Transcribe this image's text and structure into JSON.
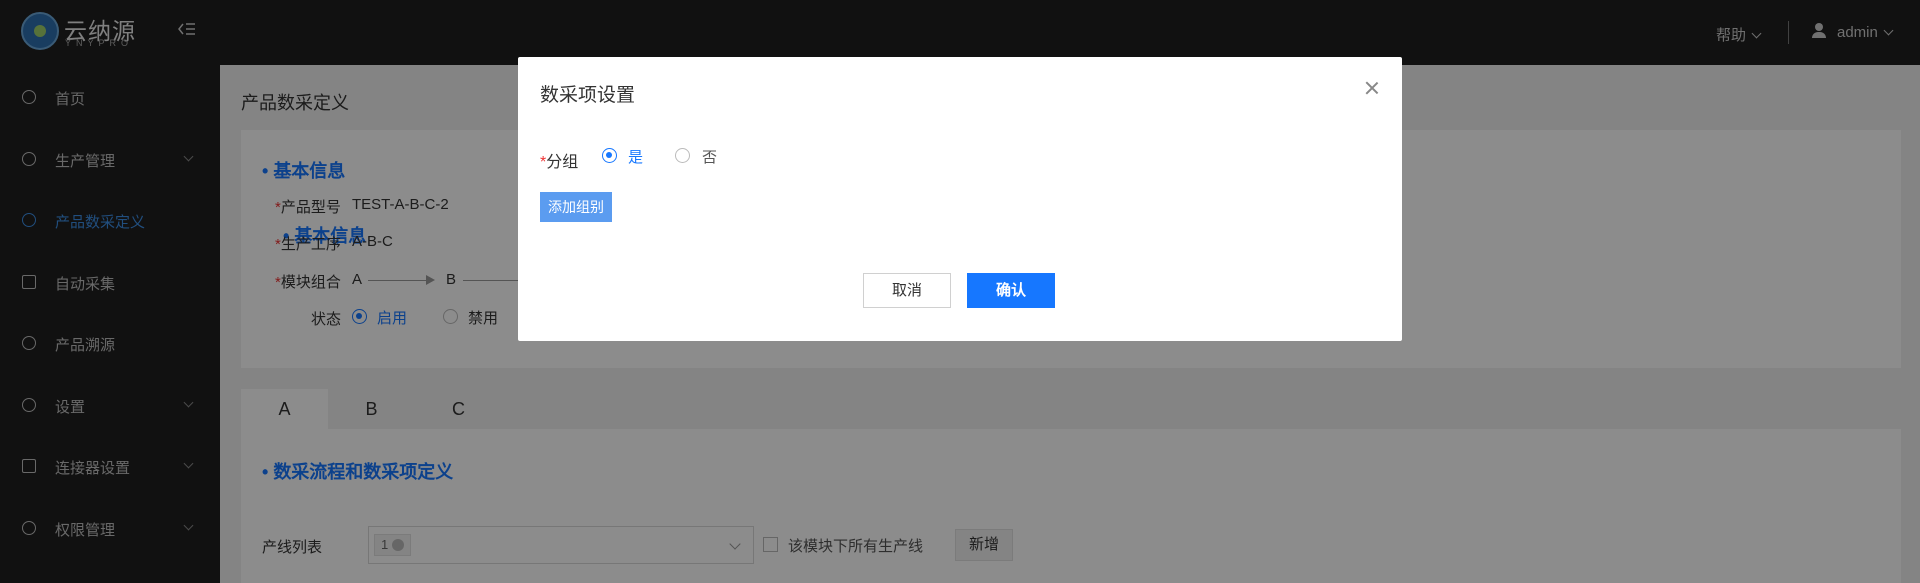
{
  "header": {
    "logo_text": "云纳源",
    "logo_sub": "YNYPRO",
    "help_label": "帮助",
    "user_name": "admin"
  },
  "sidebar": {
    "items": [
      {
        "label": "首页",
        "icon": "dashboard-icon"
      },
      {
        "label": "生产管理",
        "icon": "production-icon"
      },
      {
        "label": "产品数采定义",
        "icon": "product-def-icon",
        "active": true
      },
      {
        "label": "自动采集",
        "icon": "collect-icon"
      },
      {
        "label": "产品溯源",
        "icon": "trace-icon"
      },
      {
        "label": "设置",
        "icon": "settings-icon"
      },
      {
        "label": "连接器设置",
        "icon": "connector-icon"
      },
      {
        "label": "权限管理",
        "icon": "permission-icon"
      }
    ]
  },
  "page": {
    "title": "产品数采定义",
    "basic_info_title": "基本信息",
    "model_label": "产品型号",
    "model_value": "TEST-A-B-C-2",
    "process_label": "生产工序",
    "process_value": "A-B-C",
    "module_label": "模块组合",
    "module_nodes": [
      "A",
      "B"
    ],
    "status_label": "状态",
    "status_on": "启用",
    "status_off": "禁用",
    "tabs": [
      "A",
      "B",
      "C"
    ],
    "flow_title": "数采流程和数采项定义",
    "line_list_label": "产线列表",
    "line_tag": "1",
    "all_lines_label": "该模块下所有生产线",
    "add_label": "新增"
  },
  "modal": {
    "title": "数采项设置",
    "group_label": "分组",
    "yes_label": "是",
    "no_label": "否",
    "add_group_label": "添加组别",
    "cancel_label": "取消",
    "ok_label": "确认"
  },
  "colors": {
    "primary": "#1677ff",
    "sidebar_bg": "#1f1f1f",
    "active_nav": "#3d8fe6"
  }
}
